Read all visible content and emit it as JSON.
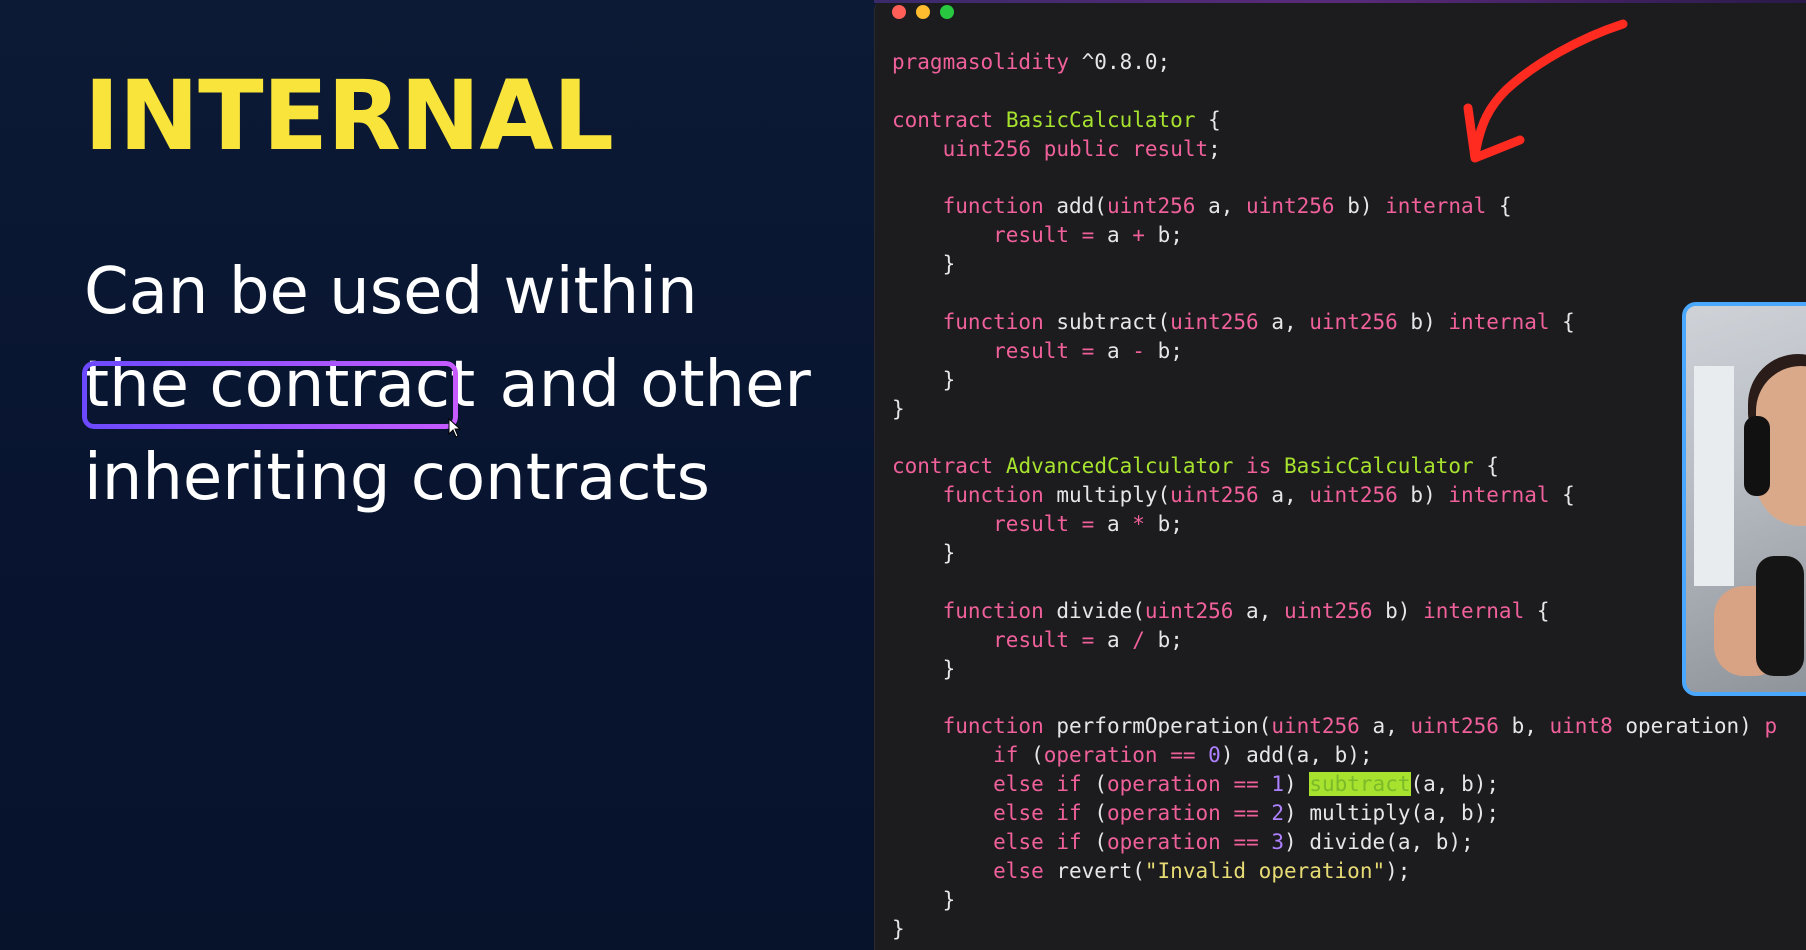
{
  "slide": {
    "title": "INTERNAL",
    "body": {
      "line1": "Can be used within",
      "highlight": "the contract",
      "line2_rest": " and other",
      "line3": "inheriting contracts"
    }
  },
  "editor": {
    "code": [
      [
        [
          "kw",
          "pragma"
        ],
        [
          " ",
          ""
        ],
        [
          "kw",
          "solidity"
        ],
        [
          "",
          " ^0.8.0;"
        ]
      ],
      [],
      [
        [
          "kw",
          "contract"
        ],
        [
          "",
          " "
        ],
        [
          "cls",
          "BasicCalculator"
        ],
        [
          "",
          " {"
        ]
      ],
      [
        [
          "",
          "    "
        ],
        [
          "ty",
          "uint256"
        ],
        [
          "",
          " "
        ],
        [
          "kw",
          "public"
        ],
        [
          "",
          " "
        ],
        [
          "kw",
          "result"
        ],
        [
          "",
          ";"
        ]
      ],
      [],
      [
        [
          "",
          "    "
        ],
        [
          "kw",
          "function"
        ],
        [
          "",
          " add("
        ],
        [
          "ty",
          "uint256"
        ],
        [
          "",
          " a, "
        ],
        [
          "ty",
          "uint256"
        ],
        [
          "",
          " b) "
        ],
        [
          "kw",
          "internal"
        ],
        [
          "",
          " {"
        ]
      ],
      [
        [
          "",
          "        "
        ],
        [
          "kw",
          "result"
        ],
        [
          "",
          " "
        ],
        [
          "op",
          "="
        ],
        [
          "",
          " a "
        ],
        [
          "op",
          "+"
        ],
        [
          "",
          " b;"
        ]
      ],
      [
        [
          "",
          "    }"
        ]
      ],
      [],
      [
        [
          "",
          "    "
        ],
        [
          "kw",
          "function"
        ],
        [
          "",
          " subtract("
        ],
        [
          "ty",
          "uint256"
        ],
        [
          "",
          " a, "
        ],
        [
          "ty",
          "uint256"
        ],
        [
          "",
          " b) "
        ],
        [
          "kw",
          "internal"
        ],
        [
          "",
          " {"
        ]
      ],
      [
        [
          "",
          "        "
        ],
        [
          "kw",
          "result"
        ],
        [
          "",
          " "
        ],
        [
          "op",
          "="
        ],
        [
          "",
          " a "
        ],
        [
          "op",
          "-"
        ],
        [
          "",
          " b;"
        ]
      ],
      [
        [
          "",
          "    }"
        ]
      ],
      [
        [
          "",
          "}"
        ]
      ],
      [],
      [
        [
          "kw",
          "contract"
        ],
        [
          "",
          " "
        ],
        [
          "cls",
          "AdvancedCalculator"
        ],
        [
          "",
          " "
        ],
        [
          "kw",
          "is"
        ],
        [
          "",
          " "
        ],
        [
          "cls",
          "BasicCalculator"
        ],
        [
          "",
          " {"
        ]
      ],
      [
        [
          "",
          "    "
        ],
        [
          "kw",
          "function"
        ],
        [
          "",
          " multiply("
        ],
        [
          "ty",
          "uint256"
        ],
        [
          "",
          " a, "
        ],
        [
          "ty",
          "uint256"
        ],
        [
          "",
          " b) "
        ],
        [
          "kw",
          "internal"
        ],
        [
          "",
          " {"
        ]
      ],
      [
        [
          "",
          "        "
        ],
        [
          "kw",
          "result"
        ],
        [
          "",
          " "
        ],
        [
          "op",
          "="
        ],
        [
          "",
          " a "
        ],
        [
          "op",
          "*"
        ],
        [
          "",
          " b;"
        ]
      ],
      [
        [
          "",
          "    }"
        ]
      ],
      [],
      [
        [
          "",
          "    "
        ],
        [
          "kw",
          "function"
        ],
        [
          "",
          " divide("
        ],
        [
          "ty",
          "uint256"
        ],
        [
          "",
          " a, "
        ],
        [
          "ty",
          "uint256"
        ],
        [
          "",
          " b) "
        ],
        [
          "kw",
          "internal"
        ],
        [
          "",
          " {"
        ]
      ],
      [
        [
          "",
          "        "
        ],
        [
          "kw",
          "result"
        ],
        [
          "",
          " "
        ],
        [
          "op",
          "="
        ],
        [
          "",
          " a "
        ],
        [
          "op",
          "/"
        ],
        [
          "",
          " b;"
        ]
      ],
      [
        [
          "",
          "    }"
        ]
      ],
      [],
      [
        [
          "",
          "    "
        ],
        [
          "kw",
          "function"
        ],
        [
          "",
          " performOperation("
        ],
        [
          "ty",
          "uint256"
        ],
        [
          "",
          " a, "
        ],
        [
          "ty",
          "uint256"
        ],
        [
          "",
          " b, "
        ],
        [
          "ty",
          "uint8"
        ],
        [
          "",
          " operation) "
        ],
        [
          "kw",
          "p"
        ]
      ],
      [
        [
          "",
          "        "
        ],
        [
          "kw",
          "if"
        ],
        [
          "",
          " ("
        ],
        [
          "kw",
          "operation"
        ],
        [
          "",
          " "
        ],
        [
          "op",
          "=="
        ],
        [
          "",
          " "
        ],
        [
          "num",
          "0"
        ],
        [
          "",
          ") add(a, b);"
        ]
      ],
      [
        [
          "",
          "        "
        ],
        [
          "kw",
          "else"
        ],
        [
          "",
          " "
        ],
        [
          "kw",
          "if"
        ],
        [
          "",
          " ("
        ],
        [
          "kw",
          "operation"
        ],
        [
          "",
          " "
        ],
        [
          "op",
          "=="
        ],
        [
          "",
          " "
        ],
        [
          "num",
          "1"
        ],
        [
          "",
          ") "
        ],
        [
          "sel",
          "subtract"
        ],
        [
          "",
          "(a, b);"
        ]
      ],
      [
        [
          "",
          "        "
        ],
        [
          "kw",
          "else"
        ],
        [
          "",
          " "
        ],
        [
          "kw",
          "if"
        ],
        [
          "",
          " ("
        ],
        [
          "kw",
          "operation"
        ],
        [
          "",
          " "
        ],
        [
          "op",
          "=="
        ],
        [
          "",
          " "
        ],
        [
          "num",
          "2"
        ],
        [
          "",
          ") multiply(a, b);"
        ]
      ],
      [
        [
          "",
          "        "
        ],
        [
          "kw",
          "else"
        ],
        [
          "",
          " "
        ],
        [
          "kw",
          "if"
        ],
        [
          "",
          " ("
        ],
        [
          "kw",
          "operation"
        ],
        [
          "",
          " "
        ],
        [
          "op",
          "=="
        ],
        [
          "",
          " "
        ],
        [
          "num",
          "3"
        ],
        [
          "",
          ") divide(a, b);"
        ]
      ],
      [
        [
          "",
          "        "
        ],
        [
          "kw",
          "else"
        ],
        [
          "",
          " revert("
        ],
        [
          "str",
          "\"Invalid operation\""
        ],
        [
          "",
          ");"
        ]
      ],
      [
        [
          "",
          "    }"
        ]
      ],
      [
        [
          "",
          "}"
        ]
      ]
    ]
  },
  "colors": {
    "title_yellow": "#f9e43b",
    "keyword_pink": "#f0609a",
    "class_green": "#a6e22e",
    "webcam_border": "#4aa8ff"
  },
  "icons": [
    "cursor-icon",
    "red-arrow-icon"
  ]
}
